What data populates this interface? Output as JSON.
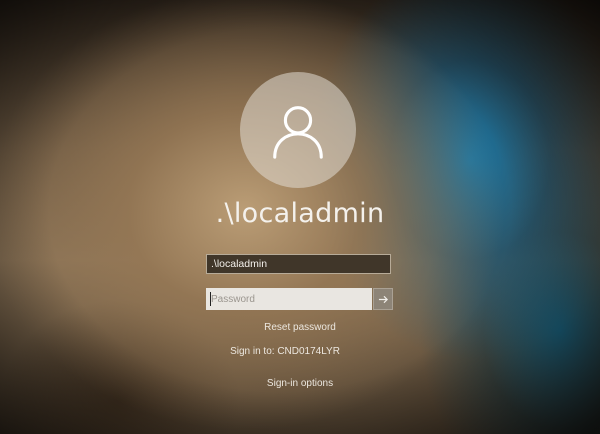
{
  "account": {
    "display_name": ".\\localadmin",
    "username_value": ".\\localadmin"
  },
  "password_field": {
    "placeholder": "Password"
  },
  "links": {
    "reset_password": "Reset password",
    "sign_in_to": "Sign in to: CND0174LYR",
    "sign_in_options": "Sign-in options"
  },
  "icons": {
    "avatar": "user-icon",
    "submit": "arrow-right-icon"
  }
}
